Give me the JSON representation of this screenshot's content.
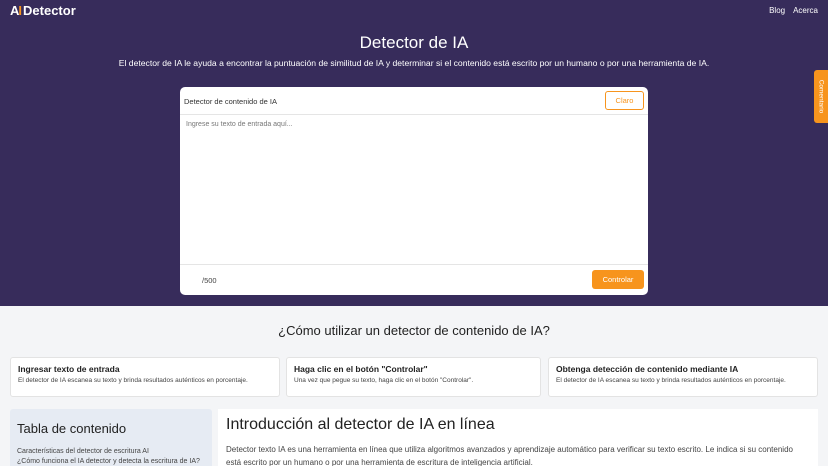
{
  "header": {
    "logo_mark": "AI",
    "logo_text": "Detector",
    "nav": [
      {
        "label": "Blog"
      },
      {
        "label": "Acerca"
      }
    ]
  },
  "hero": {
    "title": "Detector de IA",
    "subtitle": "El detector de IA le ayuda a encontrar la puntuación de similitud de IA y determinar si el contenido está escrito por un humano o por una herramienta de IA."
  },
  "editor": {
    "title": "Detector de contenido de IA",
    "clear_label": "Claro",
    "placeholder": "Ingrese su texto de entrada aquí...",
    "value": "",
    "counter": "/500",
    "check_label": "Controlar"
  },
  "feedback": {
    "label": "Comentario"
  },
  "how": {
    "title": "¿Cómo utilizar un detector de contenido de IA?",
    "steps": [
      {
        "title": "Ingresar texto de entrada",
        "desc": "El detector de IA escanea su texto y brinda resultados auténticos en porcentaje."
      },
      {
        "title": "Haga clic en el botón \"Controlar\"",
        "desc": "Una vez que pegue su texto, haga clic en el botón \"Controlar\"."
      },
      {
        "title": "Obtenga detección de contenido mediante IA",
        "desc": "El detector de IA escanea su texto y brinda resultados auténticos en porcentaje."
      }
    ]
  },
  "toc": {
    "title": "Tabla de contenido",
    "items": [
      "Características del detector de escritura AI",
      "¿Cómo funciona el IA detector y detecta la escritura de IA?"
    ]
  },
  "intro": {
    "title": "Introducción al detector de IA en línea",
    "text": "Detector texto IA es una herramienta en línea que utiliza algoritmos avanzados y aprendizaje automático para verificar su texto escrito. Le indica si su contenido está escrito por un humano o por una herramienta de escritura de inteligencia artificial."
  },
  "colors": {
    "hero_bg": "#372c5b",
    "accent": "#f7941d",
    "toc_bg": "#e6ebf3"
  }
}
